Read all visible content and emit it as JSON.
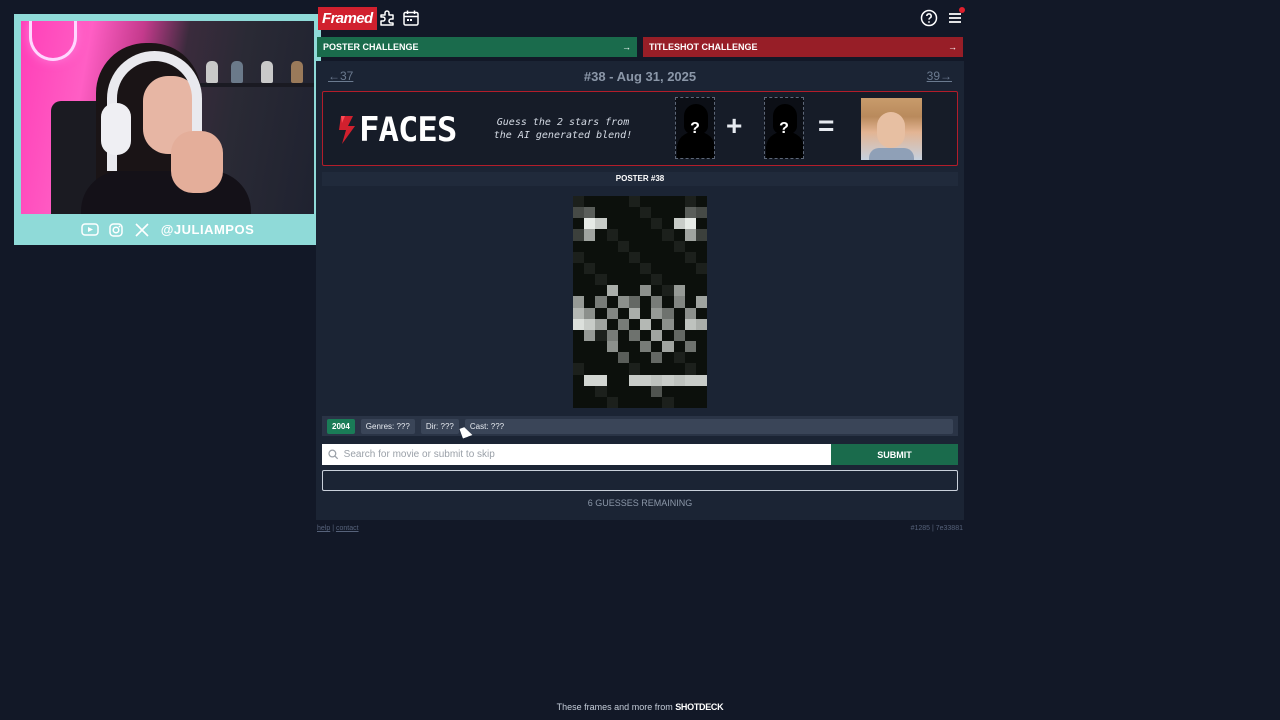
{
  "streamer": {
    "handle": "@JULIAMPOS",
    "socials": [
      "youtube-icon",
      "instagram-icon",
      "x-icon"
    ]
  },
  "app": {
    "logo": "Framed",
    "challenges": [
      {
        "label": "POSTER CHALLENGE",
        "arrow": "→",
        "color": "#1a6b4c"
      },
      {
        "label": "TITLESHOT CHALLENGE",
        "arrow": "→",
        "color": "#971e27"
      }
    ],
    "nav": {
      "prev": "←37",
      "title": "#38 - Aug 31, 2025",
      "next": "39→"
    },
    "faces_banner": {
      "logo_text": "FACES",
      "tagline": "Guess the 2 stars from\nthe AI generated blend!",
      "mystery_mark": "?",
      "plus": "+",
      "equals": "="
    },
    "poster_label": "POSTER #38",
    "clues": {
      "year": "2004",
      "genres": "Genres: ???",
      "director": "Dir: ???",
      "cast": "Cast: ???"
    },
    "search": {
      "placeholder": "Search for movie or submit to skip",
      "value": ""
    },
    "submit_label": "SUBMIT",
    "guesses_remaining": "6 GUESSES REMAINING",
    "footer": {
      "help": "help",
      "separator": "|",
      "contact": "contact",
      "build": "#1285 | 7e33881"
    }
  },
  "credit": {
    "text": "These frames and more from",
    "brand": "SHOTDECK"
  }
}
